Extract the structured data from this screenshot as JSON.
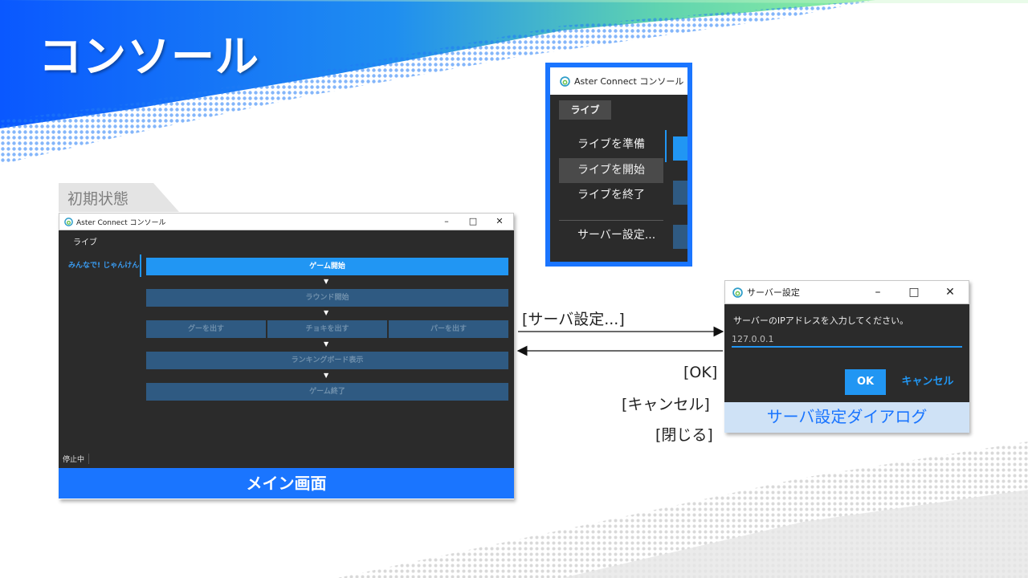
{
  "slide": {
    "title": "コンソール",
    "state_tag": "初期状態"
  },
  "main_window": {
    "title": "Aster Connect コンソール",
    "controls": {
      "minimize": "–",
      "maximize": "□",
      "close": "✕"
    },
    "menu": "ライブ",
    "side_item": "みんなで! じゃんけん",
    "flow": {
      "start_game": "ゲーム開始",
      "start_round": "ラウンド開始",
      "rock": "グーを出す",
      "scissors": "チョキを出す",
      "paper": "パーを出す",
      "ranking": "ランキングボード表示",
      "end_game": "ゲーム終了",
      "arrow": "▼"
    },
    "status": "停止中",
    "caption": "メイン画面"
  },
  "popup": {
    "title": "Aster Connect コンソール",
    "menu": "ライブ",
    "items": [
      "ライブを準備",
      "ライブを開始",
      "ライブを終了",
      "サーバー設定..."
    ]
  },
  "dialog": {
    "title": "サーバー設定",
    "controls": {
      "minimize": "–",
      "maximize": "□",
      "close": "✕"
    },
    "prompt": "サーバーのIPアドレスを入力してください。",
    "ip_value": "127.0.0.1",
    "ok": "OK",
    "cancel": "キャンセル",
    "caption": "サーバ設定ダイアログ"
  },
  "connectors": {
    "to_dialog": "[サーバ設定...]",
    "return_ok": "[OK]",
    "return_cancel": "[キャンセル]",
    "return_close": "[閉じる]"
  },
  "colors": {
    "accent": "#2196f3",
    "brand_blue": "#1a75ff",
    "dark_bg": "#2b2b2b",
    "disabled_btn": "#2f5a82"
  },
  "icons": [
    "aster-connect-app-icon"
  ]
}
